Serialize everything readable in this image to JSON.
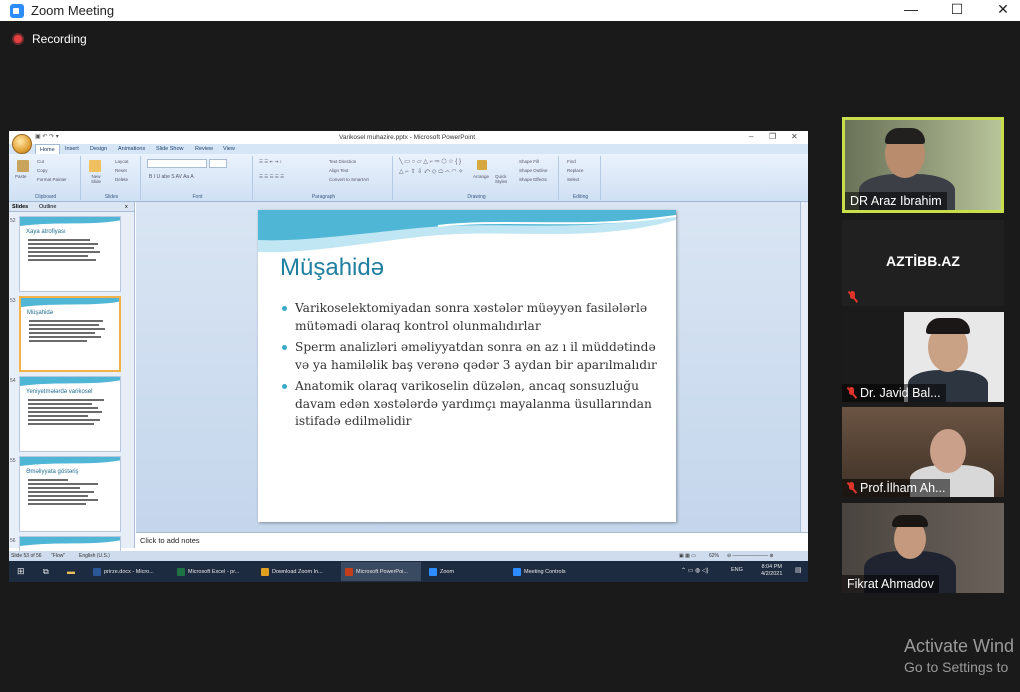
{
  "window": {
    "title": "Zoom Meeting",
    "minimize": "—",
    "maximize": "☐",
    "close": "✕"
  },
  "recording": {
    "label": "Recording"
  },
  "powerpoint": {
    "title": "Varikosel muhazire.pptx - Microsoft PowerPoint",
    "tabs": [
      "Home",
      "Insert",
      "Design",
      "Animations",
      "Slide Show",
      "Review",
      "View"
    ],
    "ribbon_groups": {
      "clipboard": {
        "label": "Clipboard",
        "paste": "Paste",
        "cut": "Cut",
        "copy": "Copy",
        "format_painter": "Format Painter"
      },
      "slides": {
        "label": "Slides",
        "new_slide": "New Slide",
        "layout": "Layout",
        "reset": "Reset",
        "delete": "Delete"
      },
      "font": {
        "label": "Font"
      },
      "paragraph": {
        "label": "Paragraph",
        "text_direction": "Text Direction",
        "align_text": "Align Text",
        "convert_smartart": "Convert to SmartArt"
      },
      "drawing": {
        "label": "Drawing",
        "arrange": "Arrange",
        "quick_styles": "Quick Styles",
        "shape_fill": "Shape Fill",
        "shape_outline": "Shape Outline",
        "shape_effects": "Shape Effects"
      },
      "editing": {
        "label": "Editing",
        "find": "Find",
        "replace": "Replace",
        "select": "Select"
      }
    },
    "pane_tabs": {
      "slides": "Slides",
      "outline": "Outline",
      "close": "x"
    },
    "thumbnails": [
      {
        "num": "52",
        "title": "Xaya atrofiyası"
      },
      {
        "num": "53",
        "title": "Müşahidə"
      },
      {
        "num": "54",
        "title": "Yeniyetmələrdə varikosel"
      },
      {
        "num": "55",
        "title": "Əməliyyata göstəriş"
      },
      {
        "num": "56",
        "title": ""
      }
    ],
    "slide": {
      "title": "Müşahidə",
      "bullets": [
        "Varikoselektomiyadan sonra xəstələr müəyyən fasilələrlə mütəmadi olaraq kontrol olunmalıdırlar",
        "Sperm analizləri əməliyyatdan sonra ən az ı il müddətində və ya hamiləlik baş verənə qədər 3 aydan bir aparılmalıdır",
        "Anatomik olaraq varikoselin düzələn, ancaq sonsuzluğu davam edən xəstələrdə yardımçı mayalanma üsullarından istifadə edilməlidir"
      ]
    },
    "notes_placeholder": "Click to add notes",
    "status": {
      "slide": "Slide 53 of 56",
      "theme": "\"Flow\"",
      "language": "English (U.S.)",
      "zoom": "62%"
    }
  },
  "taskbar": {
    "items": [
      {
        "label": "prirze.docx - Micro...",
        "color": "#2b5797"
      },
      {
        "label": "Microsoft Excel - pr...",
        "color": "#1e7145"
      },
      {
        "label": "Download Zoom In...",
        "color": "#e0a020"
      },
      {
        "label": "Microsoft PowerPoi...",
        "color": "#c43e1c"
      },
      {
        "label": "Zoom",
        "color": "#2d8cff"
      },
      {
        "label": "Meeting Controls",
        "color": "#2d8cff"
      }
    ],
    "language": "ENG",
    "time": "8:04 PM",
    "date": "4/2/2021"
  },
  "participants": [
    {
      "name": "DR Araz Ibrahim",
      "muted": false,
      "speaking": true
    },
    {
      "name": "AZTİBB.AZ",
      "muted": true,
      "speaking": false,
      "video": false
    },
    {
      "name": "Dr. Javid Bal...",
      "muted": true,
      "speaking": false
    },
    {
      "name": "Prof.İlham Ah...",
      "muted": true,
      "speaking": false
    },
    {
      "name": "Fikrat Ahmadov",
      "muted": false,
      "speaking": false
    }
  ],
  "watermark": {
    "line1": "Activate Wind",
    "line2": "Go to Settings to"
  },
  "colors": {
    "zoom_blue": "#2d8cff",
    "active_speaker": "#c8de4a",
    "mute_red": "#e0352b",
    "slide_title": "#1f7fa0",
    "bullet": "#38a9c9"
  }
}
